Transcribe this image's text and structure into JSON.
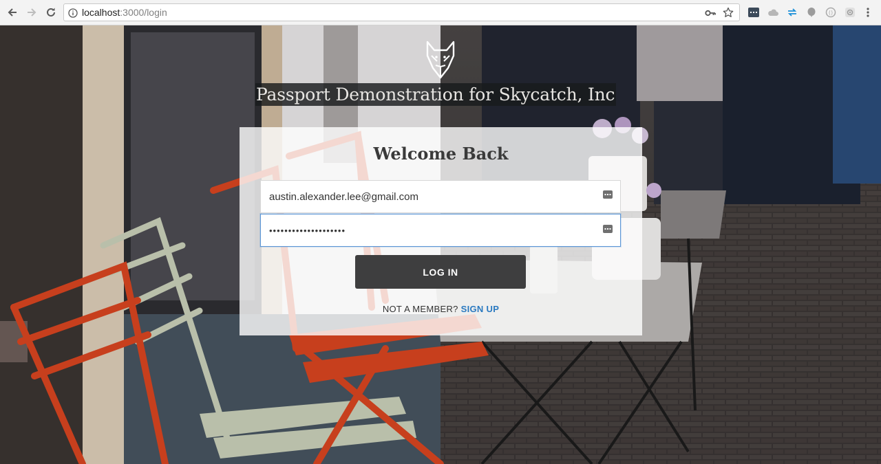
{
  "browser": {
    "url_host": "localhost",
    "url_path": ":3000/login",
    "icons": {
      "back": "back-arrow-icon",
      "forward": "forward-arrow-icon",
      "reload": "reload-icon",
      "info": "info-icon",
      "key": "key-icon",
      "star": "bookmark-star-icon",
      "extensions": [
        "extension-dark-icon",
        "cloud-drive-icon",
        "sync-arrows-icon",
        "balloon-icon",
        "circle-extension-icon",
        "gear-extension-icon",
        "menu-dots-icon"
      ]
    }
  },
  "page": {
    "logo": "fox-logo",
    "site_title": "Passport Demonstration for Skycatch, Inc",
    "card": {
      "heading": "Welcome Back",
      "email_value": "austin.alexander.lee@gmail.com",
      "password_value": "••••••••••••••••••••",
      "login_label": "LOG IN",
      "not_member_text": "NOT A MEMBER?",
      "signup_label": "SIGN UP"
    },
    "colors": {
      "button": "#3e3e3f",
      "link": "#2a79c0",
      "focus_border": "#5c96d6"
    }
  }
}
